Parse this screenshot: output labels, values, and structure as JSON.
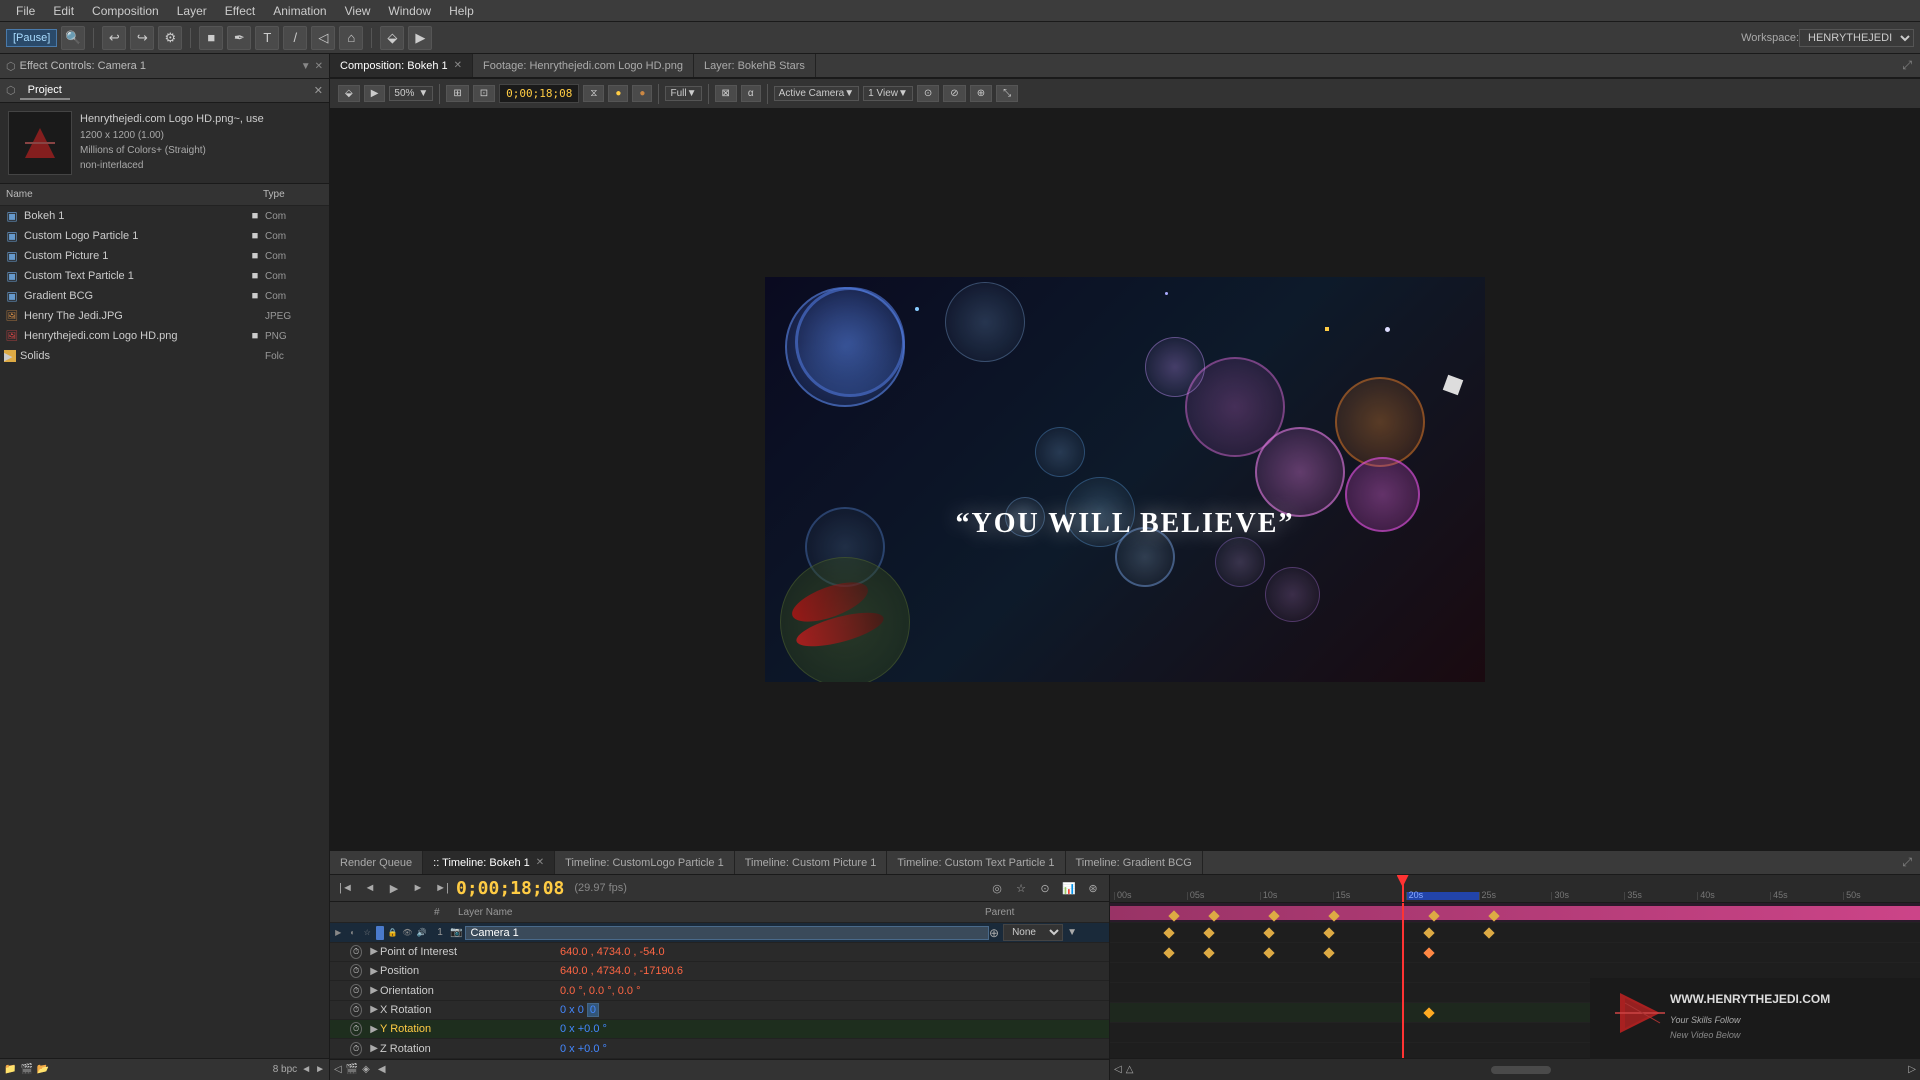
{
  "menuBar": {
    "items": [
      "File",
      "Edit",
      "Composition",
      "Layer",
      "Effect",
      "Animation",
      "View",
      "Window",
      "Help"
    ]
  },
  "toolbar": {
    "pauseLabel": "[Pause]",
    "workspaceLabel": "Workspace:",
    "workspaceValue": "HENRYTHEJEDI"
  },
  "leftPanel": {
    "projectTab": "Project",
    "effectControlsTab": "Effect Controls: Camera 1",
    "assetName": "Henrythejedi.com Logo HD.png~, use",
    "assetSize": "1200 x 1200 (1.00)",
    "assetColor": "Millions of Colors+ (Straight)",
    "assetInterlace": "non-interlaced",
    "columns": {
      "name": "Name",
      "type": "Type"
    },
    "items": [
      {
        "name": "Bokeh 1",
        "type": "Com",
        "icon": "comp",
        "marked": true
      },
      {
        "name": "Custom Logo Particle 1",
        "type": "Com",
        "icon": "comp",
        "marked": true
      },
      {
        "name": "Custom Picture 1",
        "type": "Com",
        "icon": "comp",
        "marked": true
      },
      {
        "name": "Custom Text Particle 1",
        "type": "Com",
        "icon": "comp",
        "marked": true
      },
      {
        "name": "Gradient BCG",
        "type": "Com",
        "icon": "comp",
        "marked": true
      },
      {
        "name": "Henry The Jedi.JPG",
        "type": "JPEG",
        "icon": "image",
        "marked": false
      },
      {
        "name": "Henrythejedi.com Logo HD.png",
        "type": "PNG",
        "icon": "image",
        "marked": true
      },
      {
        "name": "Solids",
        "type": "Folc",
        "icon": "folder",
        "marked": false
      }
    ]
  },
  "viewerTabs": [
    {
      "label": "Composition: Bokeh 1",
      "active": true,
      "closable": true
    },
    {
      "label": "Footage: Henrythejedi.com Logo HD.png",
      "active": false,
      "closable": false
    },
    {
      "label": "Layer: BokehB Stars",
      "active": false,
      "closable": false
    }
  ],
  "viewerControls": {
    "zoom": "50%",
    "timecode": "0;00;18;08",
    "quality": "Full",
    "camera": "Active Camera",
    "view": "1 View"
  },
  "compText": "“YOU WILL BELIEVE”",
  "timelineTabs": [
    {
      "label": "Render Queue",
      "active": false
    },
    {
      "label": ":: Timeline: Bokeh 1",
      "active": true,
      "closable": true
    },
    {
      "label": "Timeline: CustomLogo Particle 1",
      "active": false
    },
    {
      "label": "Timeline: Custom Picture 1",
      "active": false
    },
    {
      "label": "Timeline: Custom Text Particle 1",
      "active": false
    },
    {
      "label": "Timeline: Gradient BCG",
      "active": false
    }
  ],
  "timeline": {
    "timecode": "0;00;18;08",
    "fps": "(29.97 fps)",
    "layerColumns": {
      "num": "#",
      "name": "Layer Name",
      "parent": "Parent"
    },
    "layers": [
      {
        "num": "1",
        "name": "Camera 1",
        "type": "camera",
        "parentVal": "None",
        "properties": [
          {
            "name": "Point of Interest",
            "value": "640.0 , 4734.0 , -54.0",
            "hasStop": true
          },
          {
            "name": "Position",
            "value": "640.0 , 4734.0 , -17190.6",
            "hasStop": true
          },
          {
            "name": "Orientation",
            "value": "0.0 °, 0.0 °, 0.0 °",
            "hasStop": true
          },
          {
            "name": "X Rotation",
            "value": "0 x 0",
            "hasStop": true,
            "highlighted": false
          },
          {
            "name": "Y Rotation",
            "value": "0 x +0.0 °",
            "hasStop": true,
            "highlighted": true
          },
          {
            "name": "Z Rotation",
            "value": "0 x +0.0 °",
            "hasStop": true,
            "highlighted": false
          }
        ]
      }
    ],
    "rulerMarks": [
      "00s",
      "05s",
      "10s",
      "15s",
      "20s",
      "25s",
      "30s",
      "35s",
      "40s",
      "45s",
      "50s"
    ],
    "playheadPosition": "20s"
  },
  "bpc": "8 bpc"
}
